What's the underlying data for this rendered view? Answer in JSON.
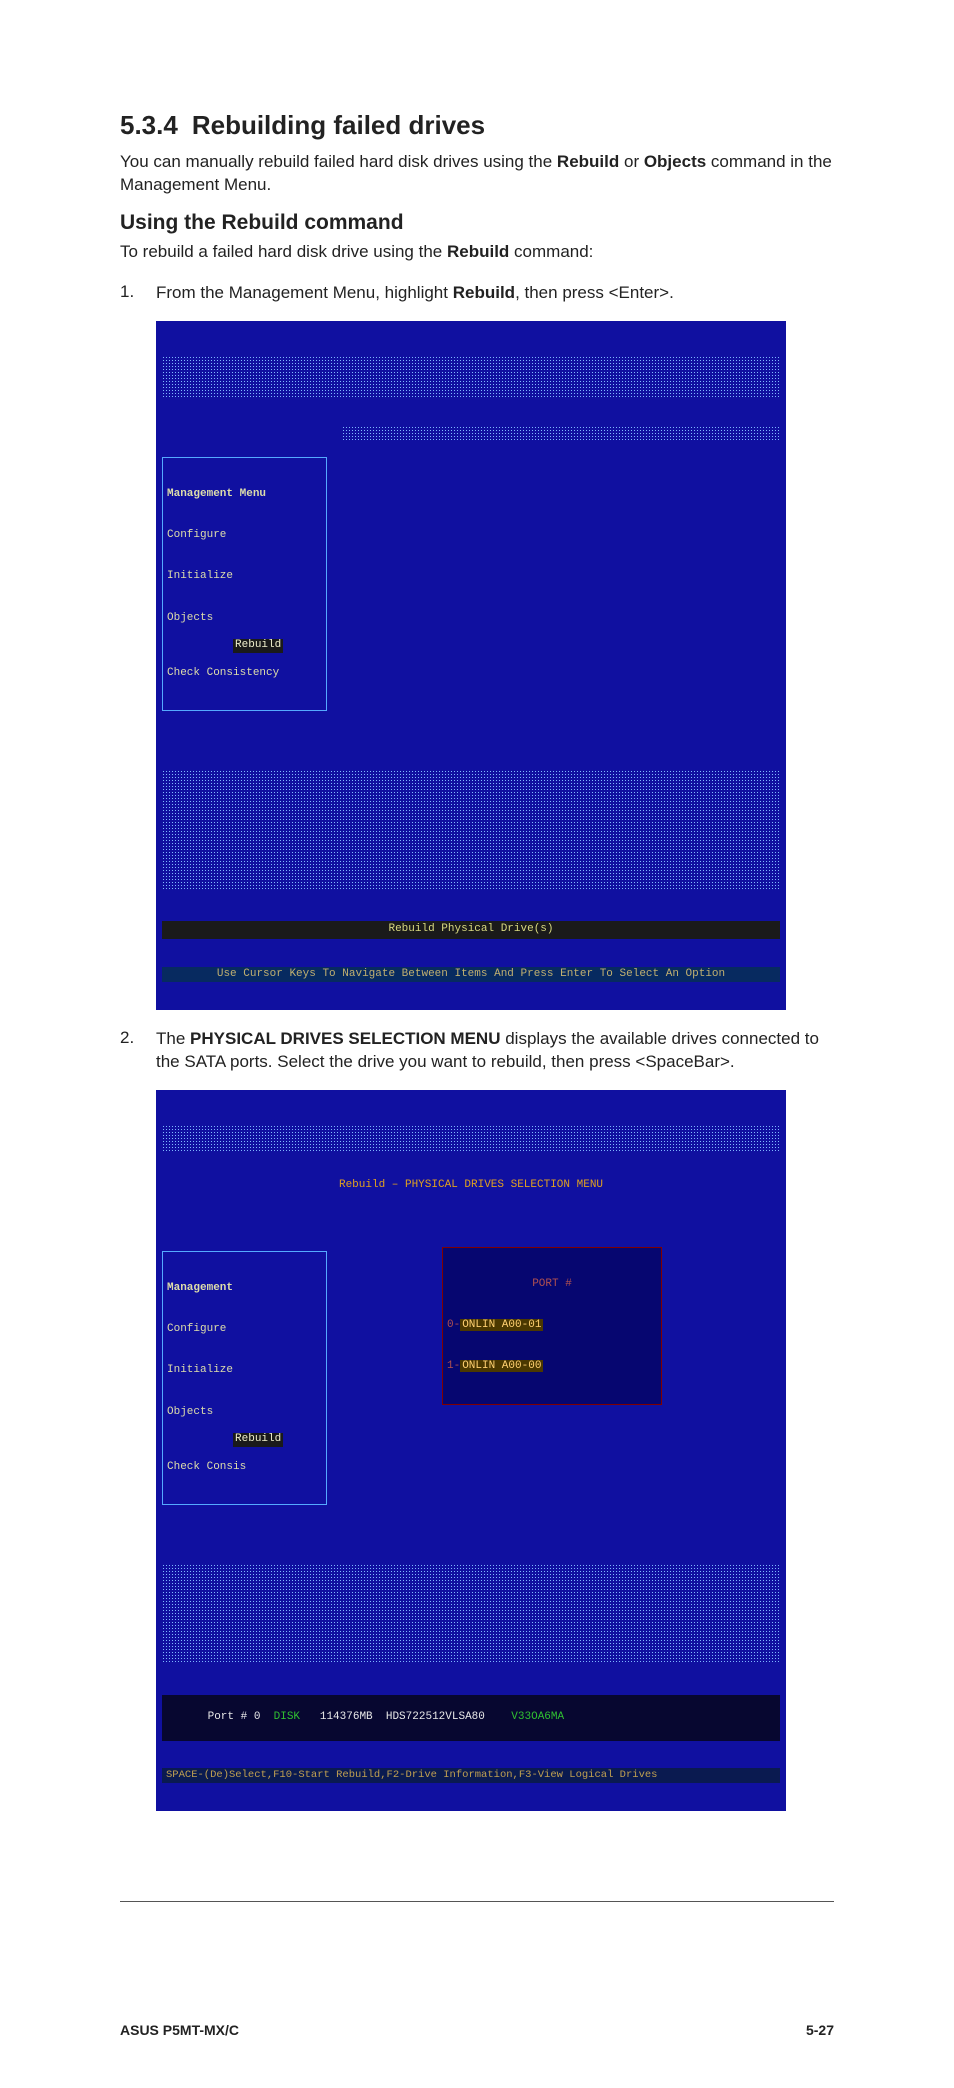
{
  "section": {
    "number": "5.3.4",
    "title": "Rebuilding failed drives"
  },
  "intro_pre": "You can manually rebuild failed hard disk drives using the ",
  "intro_bold1": "Rebuild",
  "intro_mid": " or ",
  "intro_bold2": "Objects",
  "intro_post": " command in the Management Menu.",
  "subheading": "Using the Rebuild command",
  "sub_intro_pre": "To rebuild a failed hard disk drive using the ",
  "sub_intro_bold": "Rebuild",
  "sub_intro_post": " command:",
  "steps": {
    "s1": {
      "num": "1.",
      "pre": "From the Management Menu, highlight ",
      "bold": "Rebuild",
      "post": ", then press <Enter>."
    },
    "s2": {
      "num": "2.",
      "pre": "The ",
      "bold": "PHYSICAL DRIVES SELECTION MENU",
      "post": " displays the available drives connected to the SATA ports. Select the drive you want to rebuild, then press <SpaceBar>."
    }
  },
  "screenshot1": {
    "menu_title": "Management Menu",
    "items": [
      "Configure",
      "Initialize",
      "Objects",
      "Rebuild",
      "Check Consistency"
    ],
    "highlighted": "Rebuild",
    "footer": "Rebuild Physical Drive(s)",
    "help": "Use Cursor Keys To Navigate Between Items And Press Enter To Select An Option"
  },
  "screenshot2": {
    "top_banner_prefix": "Rebuild – ",
    "top_banner_main": "PHYSICAL DRIVES SELECTION MENU",
    "menu_title": "Management",
    "items": [
      "Configure",
      "Initialize",
      "Objects",
      "Rebuild",
      "Check Consis"
    ],
    "highlighted": "Rebuild",
    "port_box": {
      "title": "PORT #",
      "line0_a": "0-",
      "line0_b": "ONLIN A00-01",
      "line1_a": "1-",
      "line1_b": "ONLIN A00-00"
    },
    "drive_bar": {
      "port": "Port # 0",
      "disk": "DISK",
      "size": "114376MB",
      "model": "HDS722512VLSA80",
      "fw": "V33OA6MA"
    },
    "help": "SPACE-(De)Select,F10-Start Rebuild,F2-Drive Information,F3-View Logical Drives"
  },
  "footer": {
    "left": "ASUS P5MT-MX/C",
    "right": "5-27"
  }
}
